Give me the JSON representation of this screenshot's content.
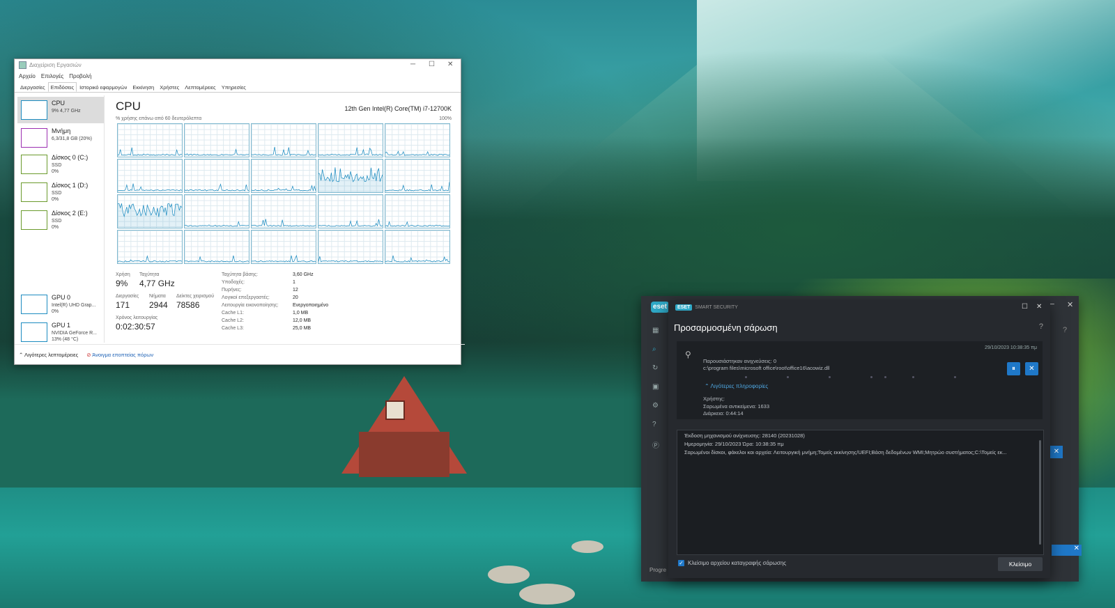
{
  "task_manager": {
    "title": "Διαχείριση Εργασιών",
    "menu": [
      "Αρχείο",
      "Επιλογές",
      "Προβολή"
    ],
    "tabs": [
      "Διεργασίες",
      "Επιδόσεις",
      "Ιστορικό εφαρμογών",
      "Εκκίνηση",
      "Χρήστες",
      "Λεπτομέρειες",
      "Υπηρεσίες"
    ],
    "active_tab": "Επιδόσεις",
    "side": [
      {
        "name": "CPU",
        "sub": "9% 4,77 GHz",
        "color": "#1b8bc0"
      },
      {
        "name": "Μνήμη",
        "sub": "6,3/31,8 GB (20%)",
        "color": "#9b2db1"
      },
      {
        "name": "Δίσκος 0 (C:)",
        "sub": "SSD\n0%",
        "color": "#6a9a2b"
      },
      {
        "name": "Δίσκος 1 (D:)",
        "sub": "SSD\n0%",
        "color": "#6a9a2b"
      },
      {
        "name": "Δίσκος 2 (E:)",
        "sub": "SSD\n0%",
        "color": "#6a9a2b"
      },
      {
        "name": "GPU 0",
        "sub": "Intel(R) UHD Grap...\n0%",
        "color": "#1b8bc0"
      },
      {
        "name": "GPU 1",
        "sub": "NVIDIA GeForce R...\n13% (48 °C)",
        "color": "#1b8bc0"
      }
    ],
    "cpu_title": "CPU",
    "cpu_model": "12th Gen Intel(R) Core(TM) i7-12700K",
    "axis_label": "% χρήσης επάνω από 60 δευτερόλεπτα",
    "axis_max": "100%",
    "stats": {
      "usage_label": "Χρήση",
      "usage": "9%",
      "speed_label": "Ταχύτητα",
      "speed": "4,77 GHz",
      "proc_label": "Διεργασίες",
      "proc": "171",
      "threads_label": "Νήματα",
      "threads": "2944",
      "handles_label": "Δείκτες χειρισμού",
      "handles": "78586",
      "uptime_label": "Χρόνος λειτουργίας",
      "uptime": "0:02:30:57"
    },
    "specs": [
      {
        "k": "Ταχύτητα βάσης:",
        "v": "3,60 GHz"
      },
      {
        "k": "Υποδοχές:",
        "v": "1"
      },
      {
        "k": "Πυρήνες:",
        "v": "12"
      },
      {
        "k": "Λογικοί επεξεργαστές:",
        "v": "20"
      },
      {
        "k": "Λειτουργία εικονοποίησης:",
        "v": "Ενεργοποιημένο"
      },
      {
        "k": "Cache L1:",
        "v": "1,0 MB"
      },
      {
        "k": "Cache L2:",
        "v": "12,0 MB"
      },
      {
        "k": "Cache L3:",
        "v": "25,0 MB"
      }
    ],
    "footer_less": "Λιγότερες λεπτομέρειες",
    "footer_open": "Άνοιγμα εποπτείας πόρων"
  },
  "eset": {
    "brand": "SMART SECURITY",
    "logo": "ESET",
    "title": "Προσαρμοσμένη σάρωση",
    "help": "?",
    "date": "29/10/2023 10:38:35 πμ",
    "found": "Παρουσιάστηκαν ανιχνεύσεις: 0",
    "path": "c:\\program files\\microsoft office\\root\\office16\\acowiz.dll",
    "less_info": "Λιγότερες πληροφορίες",
    "user": "Χρήστης:",
    "scanned": "Σαρωμένα αντικείμενα: 1633",
    "duration": "Διάρκεια: 0:44:14",
    "log": [
      "Έκδοση μηχανισμού ανίχνευσης: 28140 (20231028)",
      "Ημερομηνία: 29/10/2023   Ώρα: 10:38:35 πμ",
      "Σαρωμένοι δίσκοι, φάκελοι και αρχεία: Λειτουργική μνήμη;Τομείς εκκίνησης/UEFI;Βάση δεδομένων WMI;Μητρώο συστήματος;C:\\Τομείς εκ..."
    ],
    "checkbox_label": "Κλείσιμο αρχείου καταγραφής σάρωσης",
    "close_label": "Κλείσιμο",
    "back_partial": "Progre",
    "back_logo": "eset"
  }
}
